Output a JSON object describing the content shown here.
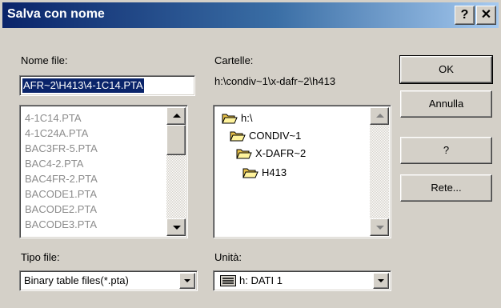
{
  "window": {
    "title": "Salva con nome",
    "help_button": "?",
    "close_button": "✕"
  },
  "file_name": {
    "label": "Nome file:",
    "value": "AFR~2\\H413\\4-1C14.PTA"
  },
  "file_list": {
    "items": [
      "4-1C14.PTA",
      "4-1C24A.PTA",
      "BAC3FR-5.PTA",
      "BAC4-2.PTA",
      "BAC4FR-2.PTA",
      "BACODE1.PTA",
      "BACODE2.PTA",
      "BACODE3.PTA"
    ]
  },
  "folders": {
    "label": "Cartelle:",
    "path": "h:\\condiv~1\\x-dafr~2\\h413",
    "items": [
      {
        "name": "h:\\",
        "icon": "open-folder-icon"
      },
      {
        "name": "CONDIV~1",
        "icon": "open-folder-icon"
      },
      {
        "name": "X-DAFR~2",
        "icon": "open-folder-icon"
      },
      {
        "name": "H413",
        "icon": "open-folder-icon"
      }
    ]
  },
  "file_type": {
    "label": "Tipo file:",
    "value": "Binary table files(*.pta)"
  },
  "drive": {
    "label": "Unità:",
    "value": "h: DATI 1",
    "icon": "drive-icon"
  },
  "buttons": {
    "ok": "OK",
    "cancel": "Annulla",
    "question": "?",
    "network": "Rete..."
  },
  "colors": {
    "title_start": "#0a246a",
    "title_end": "#a6caf0",
    "dialog_bg": "#d4d0c8",
    "selection": "#0a246a"
  }
}
